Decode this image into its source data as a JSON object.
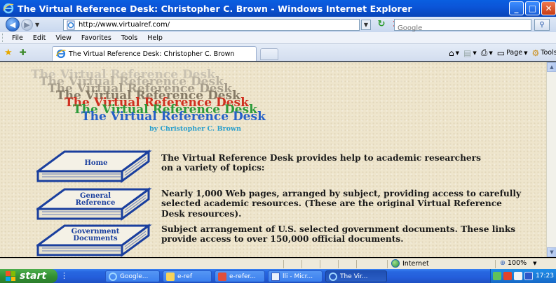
{
  "window": {
    "title": "The Virtual Reference Desk: Christopher C. Brown - Windows Internet Explorer",
    "minimize_label": "_",
    "maximize_label": "□",
    "close_label": "✕"
  },
  "address_bar": {
    "url": "http://www.virtualref.com/",
    "search_placeholder": "Google"
  },
  "menu": {
    "items": [
      "File",
      "Edit",
      "View",
      "Favorites",
      "Tools",
      "Help"
    ]
  },
  "tabs": {
    "active_tab_label": "The Virtual Reference Desk: Christopher C. Brown"
  },
  "command_bar": {
    "page_label": "Page",
    "tools_label": "Tools"
  },
  "page": {
    "logo_text": "The Virtual Reference Desk",
    "byline": "by Christopher C. Brown",
    "logo_colors": [
      "#c9c2b2",
      "#b9b1a0",
      "#a59c8a",
      "#857a66",
      "#d03020",
      "#2c9b3a",
      "#2560c8"
    ],
    "sections": [
      {
        "book_label": "Home",
        "description": "The Virtual Reference Desk provides help to academic researchers on a variety of topics:"
      },
      {
        "book_label": "General Reference",
        "book_label_lines": [
          "General",
          "Reference"
        ],
        "description": "Nearly 1,000 Web pages, arranged by subject, providing access to carefully selected academic resources. (These are the original Virtual Reference Desk resources)."
      },
      {
        "book_label": "Government Documents",
        "book_label_lines": [
          "Government",
          "Documents"
        ],
        "description": "Subject arrangement of U.S. selected government documents. These links provide access to over 150,000 official documents."
      }
    ]
  },
  "status_bar": {
    "zone": "Internet",
    "zoom": "100%"
  },
  "taskbar": {
    "start_label": "start",
    "buttons": [
      "Google...",
      "e-ref",
      "e-refer...",
      "lli - Micr...",
      "The Vir..."
    ],
    "clock": "17:23"
  }
}
